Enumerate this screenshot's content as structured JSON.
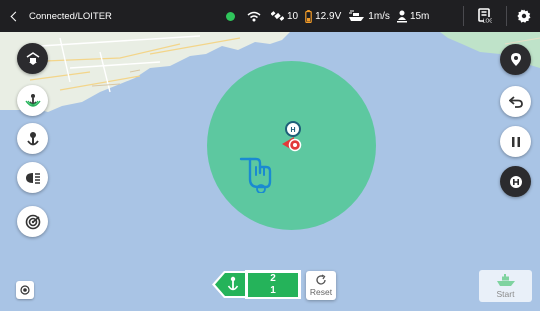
{
  "topbar": {
    "back_label": "Connected/LOITER",
    "status_color": "#2fc55b",
    "satellites": "10",
    "voltage": "12.9V",
    "speed": "1m/s",
    "distance": "15m",
    "log_icon": "log-book-icon",
    "settings_icon": "gear-icon"
  },
  "left_tools": [
    {
      "name": "collapse",
      "icon": "chevron-down-double-icon"
    },
    {
      "name": "anchor-signal",
      "icon": "anchor-signal-icon"
    },
    {
      "name": "anchor",
      "icon": "anchor-icon"
    },
    {
      "name": "light",
      "icon": "headlight-icon"
    },
    {
      "name": "sonar",
      "icon": "sonar-icon"
    }
  ],
  "right_tools": [
    {
      "name": "location",
      "icon": "location-pin-icon"
    },
    {
      "name": "return",
      "icon": "return-arrow-icon"
    },
    {
      "name": "pause",
      "icon": "pause-icon"
    },
    {
      "name": "home",
      "icon": "home-h-icon"
    }
  ],
  "map": {
    "water_color": "#a9c4e5",
    "land_color": "#e9eee4",
    "loiter_color": "#5dc8a0",
    "home_marker_label": "H"
  },
  "bottom": {
    "count_top": "2",
    "count_bottom": "1",
    "reset_label": "Reset",
    "start_label": "Start",
    "accent": "#25b35a"
  }
}
